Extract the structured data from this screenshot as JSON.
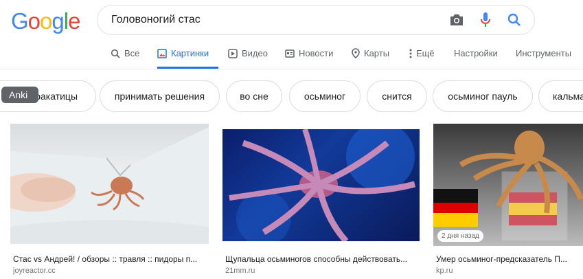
{
  "logo": {
    "letters": [
      "G",
      "o",
      "o",
      "g",
      "l",
      "e"
    ],
    "colors": [
      "#4285f4",
      "#ea4335",
      "#fbbc05",
      "#4285f4",
      "#34a853",
      "#ea4335"
    ]
  },
  "search": {
    "query": "Головоногий стас"
  },
  "tabs": [
    {
      "label": "Все",
      "icon": "search-icon"
    },
    {
      "label": "Картинки",
      "icon": "image-icon",
      "active": true
    },
    {
      "label": "Видео",
      "icon": "play-icon"
    },
    {
      "label": "Новости",
      "icon": "news-icon"
    },
    {
      "label": "Карты",
      "icon": "map-pin-icon"
    },
    {
      "label": "Ещё",
      "icon": "more-vert-icon"
    },
    {
      "label": "Настройки"
    },
    {
      "label": "Инструменты"
    }
  ],
  "tooltip": {
    "text": "Anki"
  },
  "chips": [
    "каракатицы",
    "принимать решения",
    "во сне",
    "осьминог",
    "снится",
    "осьминог пауль",
    "кальма"
  ],
  "results": [
    {
      "caption": "Стас vs Андрей! / обзоры :: травля :: пидоры п...",
      "source": "joyreactor.cc"
    },
    {
      "caption": "Щупальца осьминогов способны действовать...",
      "source": "21mm.ru"
    },
    {
      "caption": "Умер осьминог-предсказатель П...",
      "source": "kp.ru",
      "badge": "2 дня назад"
    }
  ],
  "colors": {
    "accent": "#1a73e8",
    "mic_red": "#ea4335",
    "search_blue": "#4285f4"
  }
}
